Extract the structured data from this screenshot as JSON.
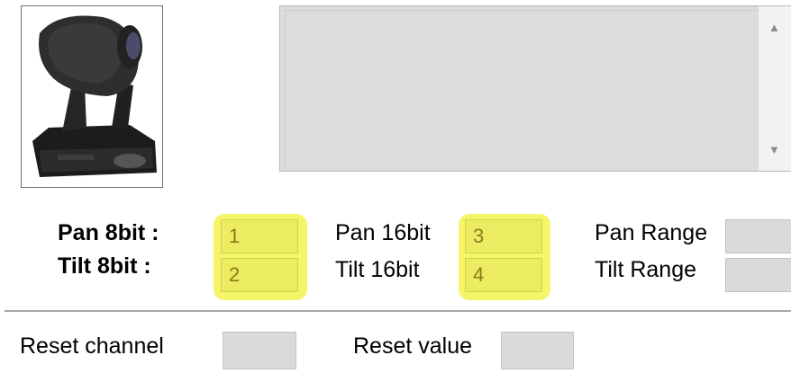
{
  "fixture": {
    "image_icon": "moving-head-fixture-icon"
  },
  "description": {
    "text": "",
    "scroll_up_icon": "scroll-up-arrow-icon",
    "scroll_down_icon": "scroll-down-arrow-icon"
  },
  "channels": {
    "pan8_label": "Pan 8bit :",
    "tilt8_label": "Tilt 8bit :",
    "pan8_value": "1",
    "tilt8_value": "2",
    "pan16_label": "Pan 16bit",
    "tilt16_label": "Tilt 16bit",
    "pan16_value": "3",
    "tilt16_value": "4",
    "pan_range_label": "Pan Range",
    "tilt_range_label": "Tilt Range",
    "pan_range_value": "",
    "tilt_range_value": ""
  },
  "reset": {
    "channel_label": "Reset channel",
    "channel_value": "",
    "value_label": "Reset value",
    "value_value": ""
  },
  "colors": {
    "highlight": "#f5f56a",
    "field_bg": "#dadada"
  }
}
